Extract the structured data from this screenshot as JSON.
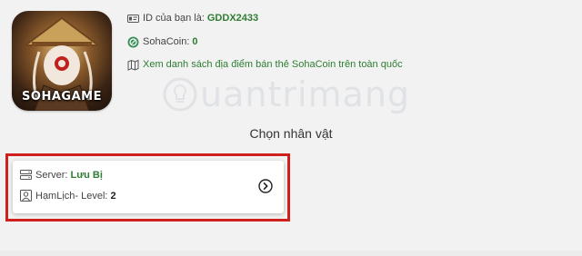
{
  "game": {
    "logo_text": "SOHAGAME",
    "icon": "game-app-icon"
  },
  "account": {
    "id_label": "ID của bạn là:",
    "id_value": "GDDX2433",
    "coin_label": "SohaCoin:",
    "coin_value": "0",
    "locations_link": "Xem danh sách địa điểm bán thẻ SohaCoin trên toàn quốc"
  },
  "watermark": {
    "text": "uantrimang"
  },
  "select_character": {
    "heading": "Chọn nhân vật"
  },
  "character_card": {
    "server_label": "Server:",
    "server_value": "Lưu Bị",
    "player_label": "HạmLịch- Level:",
    "player_value": "2"
  },
  "colors": {
    "accent_green": "#2e7d32",
    "highlight_red": "#d0201e"
  },
  "icons": {
    "id": "id-card-icon",
    "coin": "coin-icon",
    "map": "map-icon",
    "server": "server-icon",
    "user": "user-icon",
    "arrow": "chevron-right-circle-icon"
  }
}
